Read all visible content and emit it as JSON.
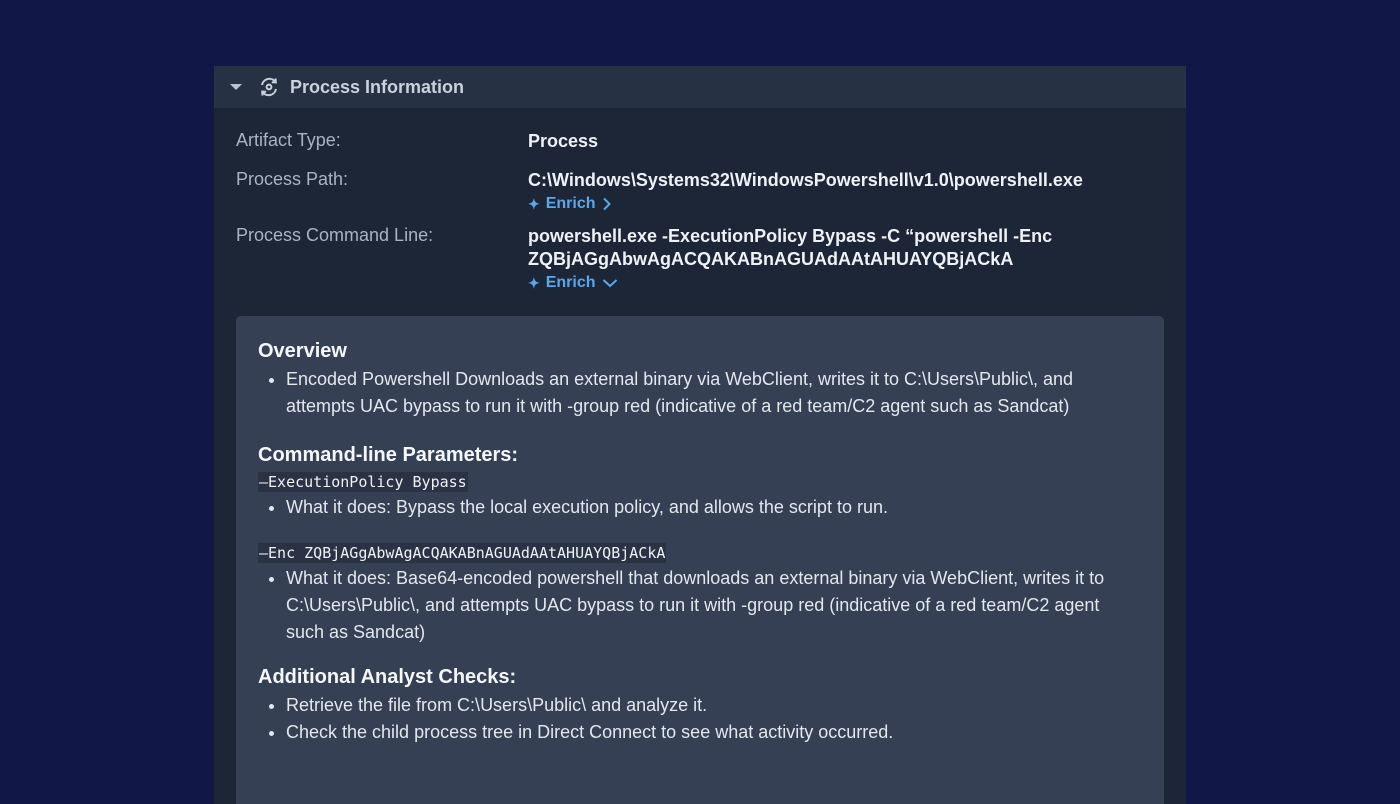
{
  "panel": {
    "title": "Process Information",
    "icon": "process-icon"
  },
  "fields": {
    "artifact_type_label": "Artifact Type:",
    "artifact_type_value": "Process",
    "process_path_label": "Process Path:",
    "process_path_value": "C:\\Windows\\Systems32\\WindowsPowershell\\v1.0\\powershell.exe",
    "command_line_label": "Process Command Line:",
    "command_line_value_1": "powershell.exe -ExecutionPolicy Bypass -C “powershell -Enc",
    "command_line_value_2": "ZQBjAGgAbwAgACQAKABnAGUAdAAtAHUAYQBjACkA",
    "enrich_label": "Enrich"
  },
  "summary": {
    "overview_heading": "Overview",
    "overview_items": [
      "Encoded Powershell Downloads an external binary via WebClient, writes it to C:\\Users\\Public\\, and attempts UAC bypass to run it with -group red (indicative of a red team/C2 agent such as Sandcat)"
    ],
    "params_heading": "Command-line Parameters:",
    "param1_code": "–ExecutionPolicy Bypass",
    "param1_desc": "What it does: Bypass the local execution policy, and allows the script to run.",
    "param2_code": "–Enc ZQBjAGgAbwAgACQAKABnAGUAdAAtAHUAYQBjACkA",
    "param2_desc": "What it does: Base64-encoded powershell that downloads an external binary via WebClient, writes it to C:\\Users\\Public\\, and attempts UAC bypass to run it with -group red (indicative of a red team/C2 agent such as Sandcat)",
    "checks_heading": "Additional Analyst Checks:",
    "checks_items": [
      "Retrieve the file from C:\\Users\\Public\\ and analyze it.",
      "Check the child process tree in Direct Connect to see what activity occurred."
    ]
  },
  "colors": {
    "background": "#111848",
    "panel": "#1d2637",
    "header": "#263244",
    "summary_card": "#354055",
    "accent": "#5aa8ec"
  }
}
